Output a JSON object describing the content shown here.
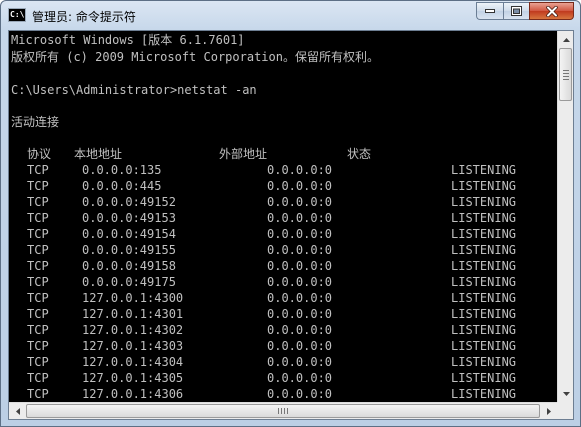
{
  "window": {
    "title": "管理员: 命令提示符",
    "icon_label": "C:\\",
    "icon": "cmd-icon"
  },
  "controls": {
    "minimize_icon": "minimize-icon",
    "maximize_icon": "maximize-icon",
    "close_icon": "close-icon"
  },
  "console": {
    "header_line1": "Microsoft Windows [版本 6.1.7601]",
    "header_line2": "版权所有 (c) 2009 Microsoft Corporation。保留所有权利。",
    "prompt": "C:\\Users\\Administrator>netstat -an",
    "section_title": "活动连接",
    "columns": {
      "protocol": "协议",
      "local": "本地地址",
      "foreign": "外部地址",
      "state": "状态"
    },
    "rows": [
      {
        "proto": "TCP",
        "local": "0.0.0.0:135",
        "foreign": "0.0.0.0:0",
        "state": "LISTENING"
      },
      {
        "proto": "TCP",
        "local": "0.0.0.0:445",
        "foreign": "0.0.0.0:0",
        "state": "LISTENING"
      },
      {
        "proto": "TCP",
        "local": "0.0.0.0:49152",
        "foreign": "0.0.0.0:0",
        "state": "LISTENING"
      },
      {
        "proto": "TCP",
        "local": "0.0.0.0:49153",
        "foreign": "0.0.0.0:0",
        "state": "LISTENING"
      },
      {
        "proto": "TCP",
        "local": "0.0.0.0:49154",
        "foreign": "0.0.0.0:0",
        "state": "LISTENING"
      },
      {
        "proto": "TCP",
        "local": "0.0.0.0:49155",
        "foreign": "0.0.0.0:0",
        "state": "LISTENING"
      },
      {
        "proto": "TCP",
        "local": "0.0.0.0:49158",
        "foreign": "0.0.0.0:0",
        "state": "LISTENING"
      },
      {
        "proto": "TCP",
        "local": "0.0.0.0:49175",
        "foreign": "0.0.0.0:0",
        "state": "LISTENING"
      },
      {
        "proto": "TCP",
        "local": "127.0.0.1:4300",
        "foreign": "0.0.0.0:0",
        "state": "LISTENING"
      },
      {
        "proto": "TCP",
        "local": "127.0.0.1:4301",
        "foreign": "0.0.0.0:0",
        "state": "LISTENING"
      },
      {
        "proto": "TCP",
        "local": "127.0.0.1:4302",
        "foreign": "0.0.0.0:0",
        "state": "LISTENING"
      },
      {
        "proto": "TCP",
        "local": "127.0.0.1:4303",
        "foreign": "0.0.0.0:0",
        "state": "LISTENING"
      },
      {
        "proto": "TCP",
        "local": "127.0.0.1:4304",
        "foreign": "0.0.0.0:0",
        "state": "LISTENING"
      },
      {
        "proto": "TCP",
        "local": "127.0.0.1:4305",
        "foreign": "0.0.0.0:0",
        "state": "LISTENING"
      },
      {
        "proto": "TCP",
        "local": "127.0.0.1:4306",
        "foreign": "0.0.0.0:0",
        "state": "LISTENING"
      }
    ]
  },
  "scrollbars": {
    "up_icon": "scroll-up-arrow-icon",
    "down_icon": "scroll-down-arrow-icon",
    "left_icon": "scroll-left-arrow-icon",
    "right_icon": "scroll-right-arrow-icon"
  }
}
